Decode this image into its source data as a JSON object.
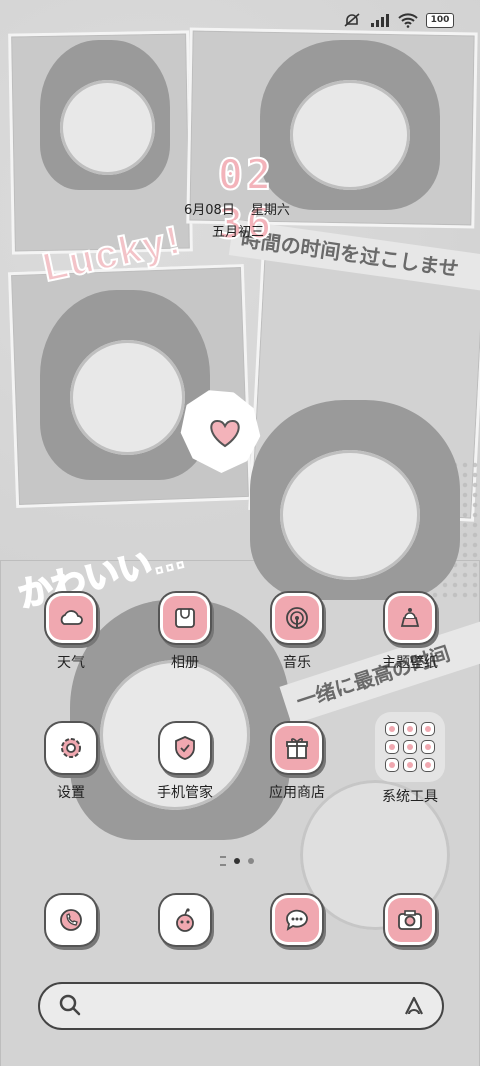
{
  "status_bar": {
    "battery": "100",
    "icons": [
      "mute-icon",
      "signal-icon",
      "wifi-icon",
      "battery-icon"
    ]
  },
  "wallpaper": {
    "lucky_text": "Lucky!",
    "kawaii_text": "かわいい…",
    "strip_text_1": "時間の时间を过こしませ",
    "strip_text_2": "一绪に最高の时间"
  },
  "clock": {
    "time": "02 36",
    "date": "6月08日",
    "weekday": "星期六",
    "lunar": "五月初三"
  },
  "apps": [
    {
      "label": "天气",
      "icon": "weather-icon"
    },
    {
      "label": "相册",
      "icon": "gallery-icon"
    },
    {
      "label": "音乐",
      "icon": "music-icon"
    },
    {
      "label": "主题壁纸",
      "icon": "theme-icon"
    },
    {
      "label": "设置",
      "icon": "settings-icon"
    },
    {
      "label": "手机管家",
      "icon": "security-icon"
    },
    {
      "label": "应用商店",
      "icon": "app-store-icon"
    },
    {
      "label": "系统工具",
      "icon": "folder-icon"
    }
  ],
  "dock": [
    "phone-icon",
    "browser-icon",
    "messages-icon",
    "camera-icon"
  ],
  "colors": {
    "accent": "#f0a8b0",
    "outline": "#555555"
  }
}
